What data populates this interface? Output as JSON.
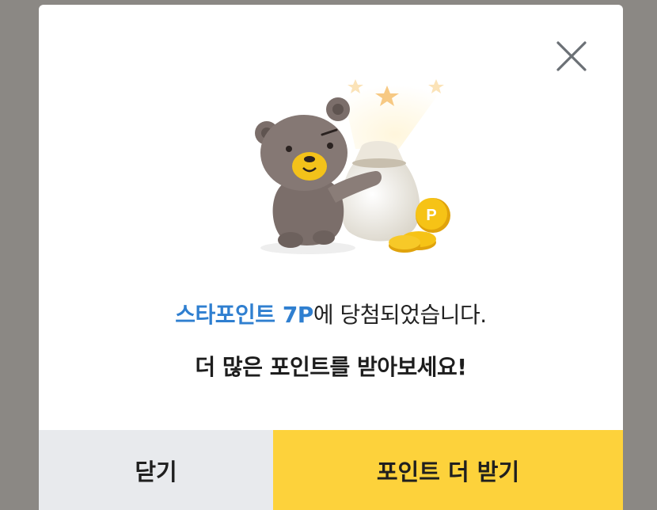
{
  "dialog": {
    "message_highlight": "스타포인트 7P",
    "message_rest": "에 당첨되었습니다.",
    "message_sub": "더 많은 포인트를 받아보세요!",
    "close_button_label": "닫기",
    "more_points_button_label": "포인트 더 받기",
    "illustration_coin_letter": "P"
  },
  "colors": {
    "overlay": "#8b8884",
    "highlight_text": "#2f7fd0",
    "close_button_bg": "#e8eaed",
    "primary_button_bg": "#fdd23b",
    "bear": "#7b6e6a",
    "bear_face": "#f3c21a",
    "coin": "#f6c316"
  },
  "icons": {
    "close": "close-icon",
    "illustration": "bear-with-point-bag-illustration"
  }
}
